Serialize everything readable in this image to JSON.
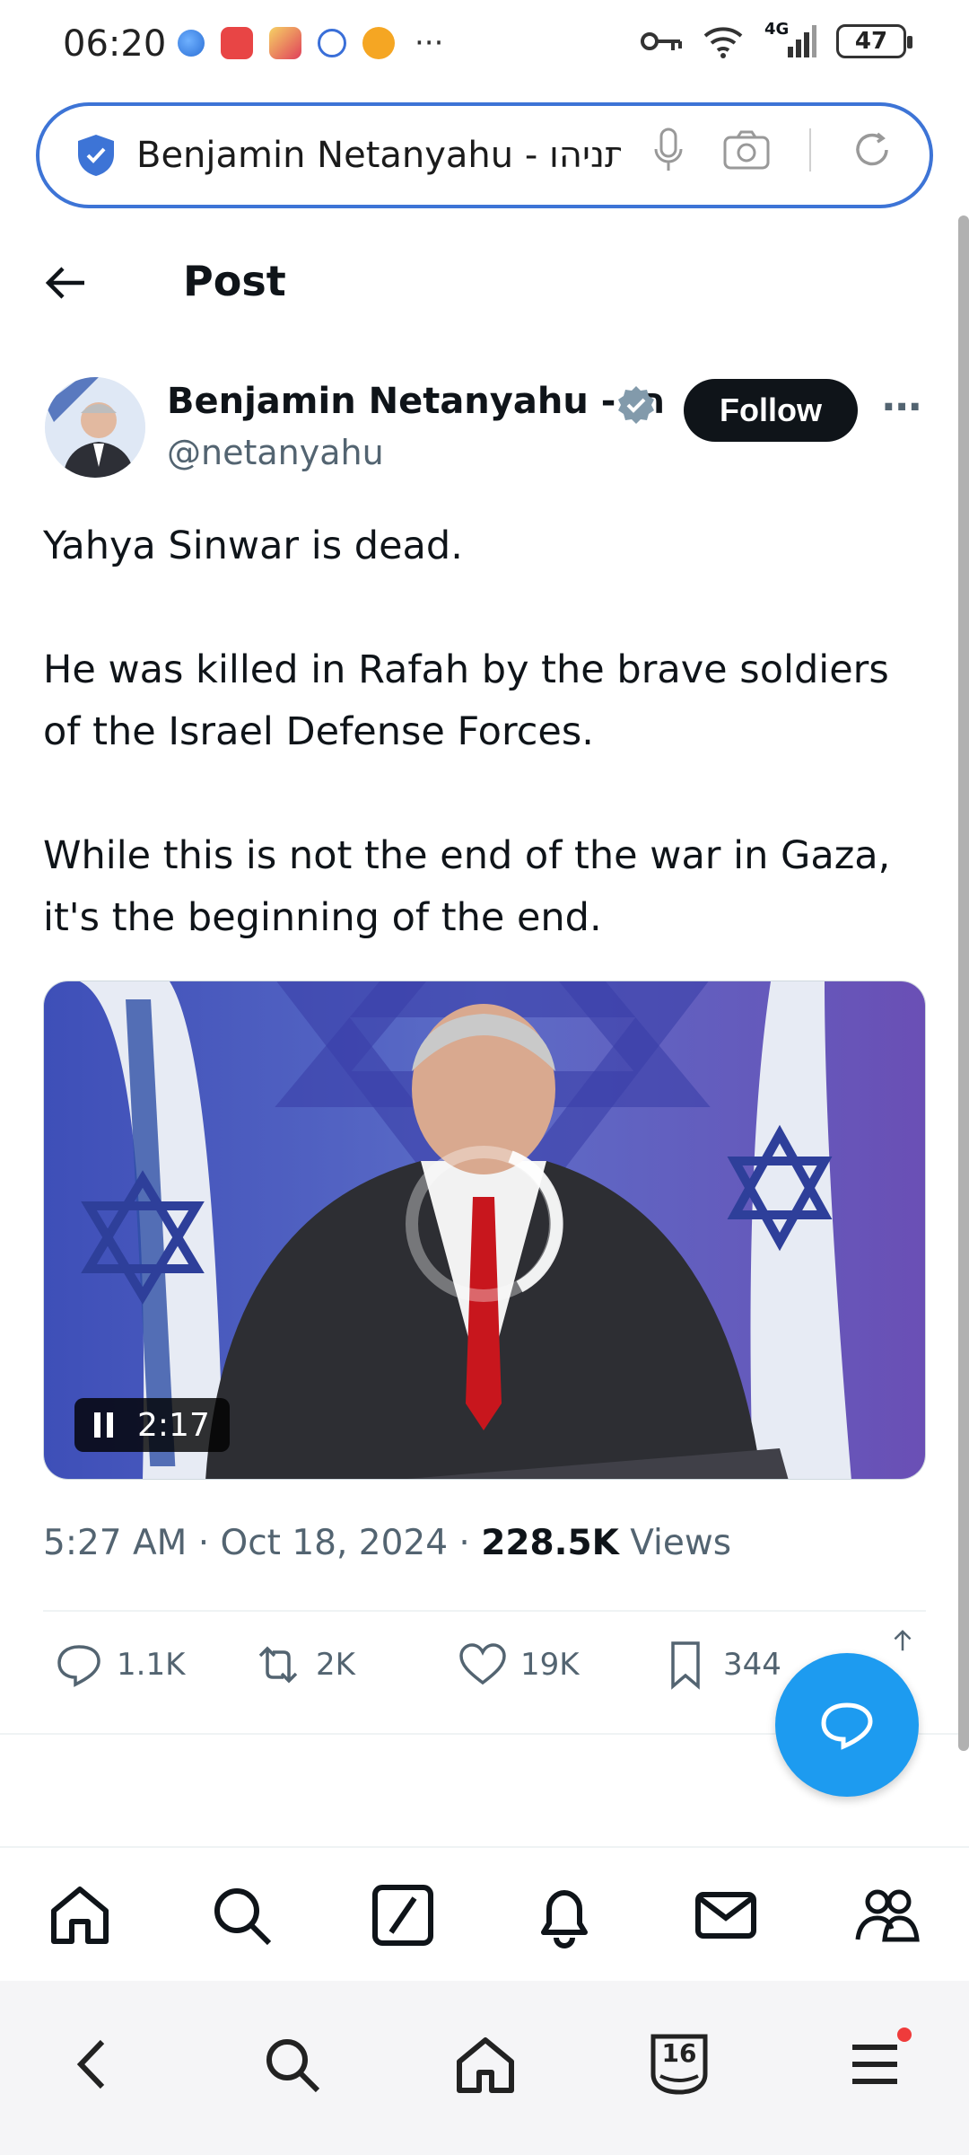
{
  "status_bar": {
    "time": "06:20",
    "more": "···",
    "network": "4G",
    "battery": "47"
  },
  "browser": {
    "url_text": "Benjamin Netanyahu - בנימין נתניהו"
  },
  "post_header": {
    "title": "Post"
  },
  "author": {
    "name": "Benjamin Netanyahu - הו",
    "handle": "@netanyahu",
    "follow_label": "Follow",
    "more_label": "···"
  },
  "post": {
    "paragraphs": [
      "Yahya Sinwar is dead.",
      "He was killed in Rafah by the brave soldiers of the Israel Defense Forces.",
      "While this is not the end of the war in Gaza, it's the beginning of the end."
    ],
    "video_time": "2:17"
  },
  "meta": {
    "time": "5:27 AM",
    "sep1": " · ",
    "date": "Oct 18, 2024",
    "sep2": " · ",
    "views_count": "228.5K",
    "views_label": " Views"
  },
  "actions": {
    "replies": "1.1K",
    "reposts": "2K",
    "likes": "19K",
    "bookmarks": "344"
  },
  "browser_nav": {
    "tabs_count": "16"
  },
  "colors": {
    "accent": "#1d9bf0",
    "url_border": "#3d74d6",
    "text_secondary": "#536471"
  }
}
